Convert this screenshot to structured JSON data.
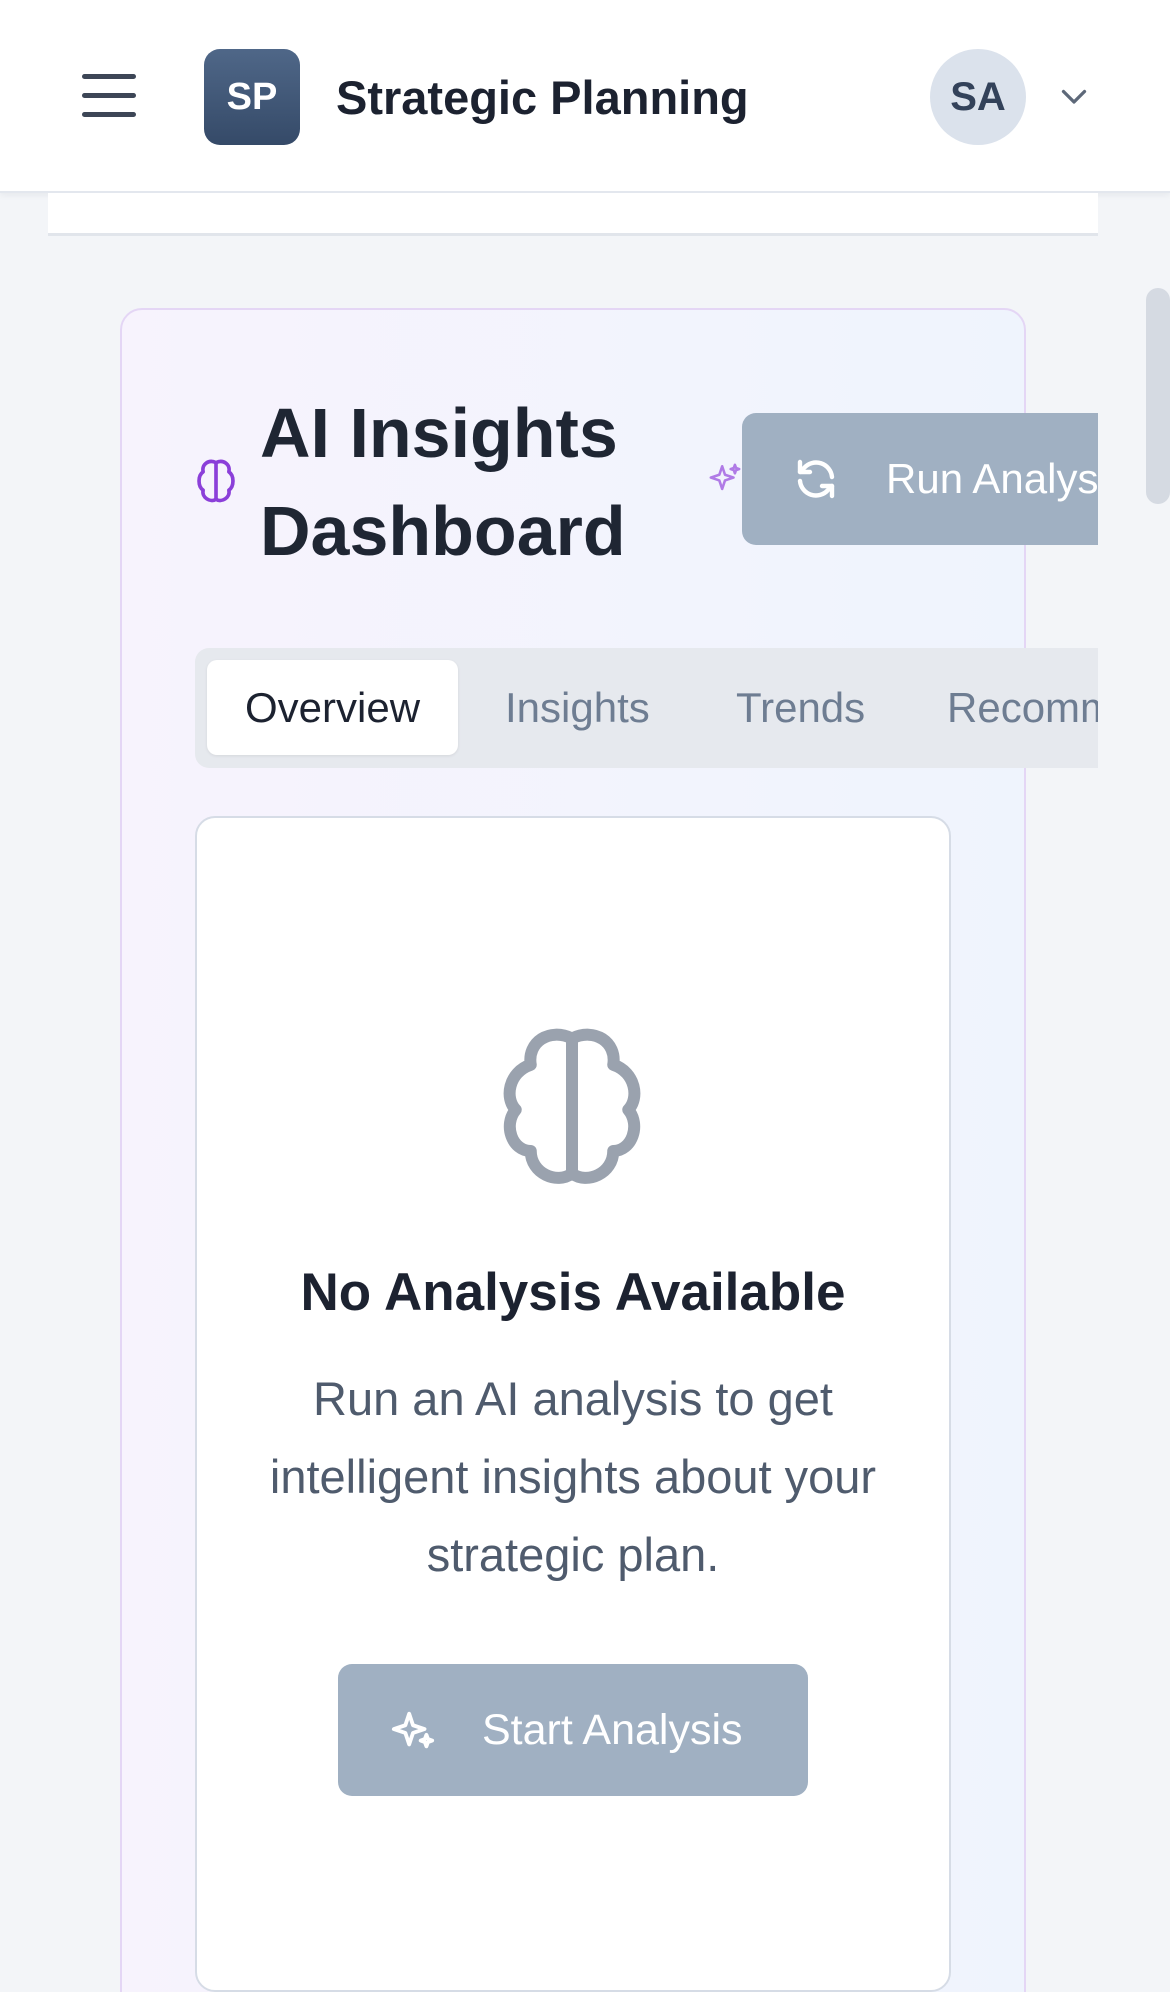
{
  "header": {
    "menu_icon": "hamburger-menu-icon",
    "logo_text": "SP",
    "app_title": "Strategic Planning",
    "avatar_initials": "SA",
    "account_icon": "chevron-down-icon"
  },
  "dashboard": {
    "title": "AI Insights Dashboard",
    "title_icon": "brain-icon",
    "accent_icon": "sparkles-icon",
    "run_button_label": "Run Analysis",
    "run_button_icon": "refresh-icon",
    "accent_color": "#8b3fd9"
  },
  "tabs": [
    {
      "label": "Overview",
      "active": true
    },
    {
      "label": "Insights",
      "active": false
    },
    {
      "label": "Trends",
      "active": false
    },
    {
      "label": "Recommendations",
      "active": false
    }
  ],
  "empty_state": {
    "icon": "brain-icon",
    "title": "No Analysis Available",
    "description": "Run an AI analysis to get intelligent insights about your strategic plan.",
    "button_label": "Start Analysis",
    "button_icon": "sparkles-icon"
  }
}
